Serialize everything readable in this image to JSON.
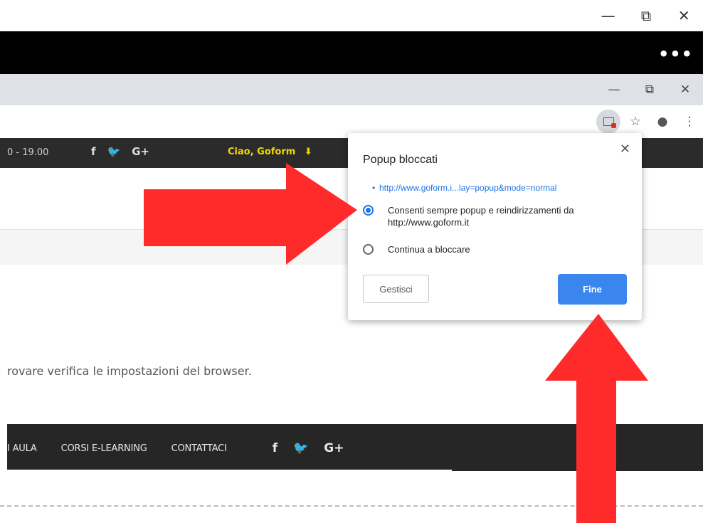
{
  "outer_window": {
    "controls": {
      "minimize": "—",
      "restore": "⧉",
      "close": "✕"
    },
    "menu": "•••"
  },
  "inner_window": {
    "controls": {
      "minimize": "—",
      "restore": "⧉",
      "close": "✕"
    }
  },
  "address_bar": {
    "icons": {
      "bookmark": "☆",
      "account": "●",
      "menu": "⋮"
    }
  },
  "site": {
    "hours": "0 - 19.00",
    "social": [
      "f",
      "🐦",
      "G+"
    ],
    "greeting": "Ciao, Goform",
    "greeting_arrow": "⬇",
    "message": "rovare verifica le impostazioni del browser.",
    "nav": [
      "I AULA",
      "CORSI E-LEARNING",
      "CONTATTACI"
    ],
    "nav_social": [
      "f",
      "🐦",
      "G+"
    ]
  },
  "popup": {
    "title": "Popup bloccati",
    "link": "http://www.goform.i...lay=popup&mode=normal",
    "option_allow_line1": "Consenti sempre popup e reindirizzamenti da",
    "option_allow_line2": "http://www.goform.it",
    "option_block": "Continua a bloccare",
    "manage_label": "Gestisci",
    "done_label": "Fine",
    "close": "✕"
  },
  "colors": {
    "annotation_arrow": "#ff2a2a",
    "done_button": "#3a86ee",
    "greeting": "#f2d600"
  }
}
